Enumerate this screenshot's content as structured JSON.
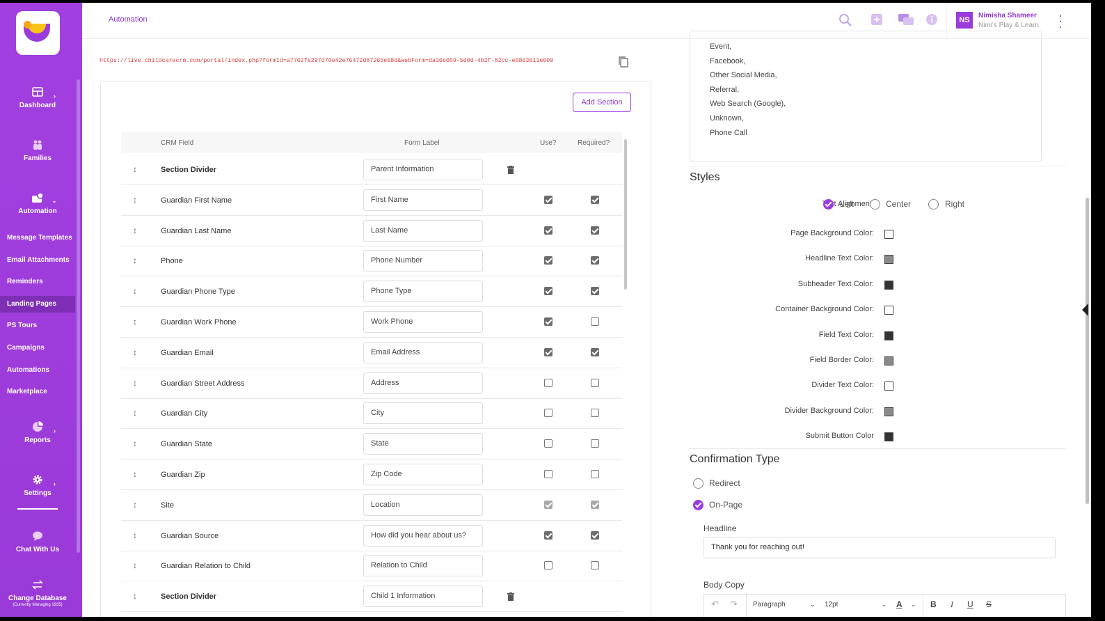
{
  "app": {
    "breadcrumb": "Automation",
    "user": {
      "initials": "NS",
      "name": "Nimisha Shameer",
      "org": "Nimi's Play & Learn"
    },
    "accent_color": "#9b3bdc"
  },
  "sidebar": {
    "main_items": [
      {
        "label": "Dashboard",
        "icon": "dashboard-icon"
      },
      {
        "label": "Families",
        "icon": "families-icon"
      },
      {
        "label": "Automation",
        "icon": "automation-icon"
      }
    ],
    "sub_items": [
      "Message Templates",
      "Email Attachments",
      "Reminders",
      "Landing Pages",
      "PS Tours",
      "Campaigns",
      "Automations",
      "Marketplace"
    ],
    "active_sub_item": "Landing Pages",
    "lower_items": [
      {
        "label": "Reports",
        "icon": "reports-icon"
      },
      {
        "label": "Settings",
        "icon": "gear-icon"
      },
      {
        "label": "Chat With Us",
        "icon": "chat-icon"
      }
    ],
    "change_db": {
      "label": "Change Database",
      "sub": "(Currently Managing 1935)"
    }
  },
  "form": {
    "url": "https://live.childcarecrm.com/portal/index.php?formId=a7762fe297d70e42e76472d87265e68d&webForm=da36e059-5d0d-4b2f-82cc-e0863011e609",
    "add_section_label": "Add Section",
    "columns": {
      "crm_field": "CRM Field",
      "form_label": "Form Label",
      "use": "Use?",
      "required": "Required?"
    },
    "rows": [
      {
        "field": "Section Divider",
        "label": "Parent Information",
        "divider": true
      },
      {
        "field": "Guardian First Name",
        "label": "First Name",
        "use": true,
        "required": true
      },
      {
        "field": "Guardian Last Name",
        "label": "Last Name",
        "use": true,
        "required": true
      },
      {
        "field": "Phone",
        "label": "Phone Number",
        "use": true,
        "required": true
      },
      {
        "field": "Guardian Phone Type",
        "label": "Phone Type",
        "use": true,
        "required": true
      },
      {
        "field": "Guardian Work Phone",
        "label": "Work Phone",
        "use": true,
        "required": false
      },
      {
        "field": "Guardian Email",
        "label": "Email Address",
        "use": true,
        "required": true
      },
      {
        "field": "Guardian Street Address",
        "label": "Address",
        "use": false,
        "required": false
      },
      {
        "field": "Guardian City",
        "label": "City",
        "use": false,
        "required": false
      },
      {
        "field": "Guardian State",
        "label": "State",
        "use": false,
        "required": false
      },
      {
        "field": "Guardian Zip",
        "label": "Zip Code",
        "use": false,
        "required": false
      },
      {
        "field": "Site",
        "label": "Location",
        "use": true,
        "required": true,
        "locked": true
      },
      {
        "field": "Guardian Source",
        "label": "How did you hear about us?",
        "use": true,
        "required": true
      },
      {
        "field": "Guardian Relation to Child",
        "label": "Relation to Child",
        "use": false,
        "required": false
      },
      {
        "field": "Section Divider",
        "label": "Child 1 Information",
        "divider": true
      }
    ]
  },
  "sources": [
    "Event,",
    "Facebook,",
    "Other Social Media,",
    "Referral,",
    "Web Search (Google),",
    "Unknown,",
    "Phone Call"
  ],
  "styles": {
    "title": "Styles",
    "text_alignment": {
      "label": "Text Alignment:",
      "options": [
        "Left",
        "Center",
        "Right"
      ],
      "selected": "Left"
    },
    "colors": [
      {
        "label": "Page Background Color:",
        "color": "#ffffff"
      },
      {
        "label": "Headline Text Color:",
        "color": "#8a8a8a"
      },
      {
        "label": "Subheader Text Color:",
        "color": "#333333"
      },
      {
        "label": "Container Background Color:",
        "color": "#ffffff"
      },
      {
        "label": "Field Text Color:",
        "color": "#333333"
      },
      {
        "label": "Field Border Color:",
        "color": "#8a8a8a"
      },
      {
        "label": "Divider Text Color:",
        "color": "#ffffff"
      },
      {
        "label": "Divider Background Color:",
        "color": "#8a8a8a"
      },
      {
        "label": "Submit Button Color",
        "color": "#333333"
      }
    ]
  },
  "confirmation": {
    "title": "Confirmation Type",
    "options": [
      "Redirect",
      "On-Page"
    ],
    "selected": "On-Page",
    "headline_label": "Headline",
    "headline_value": "Thank you for reaching out!",
    "body_label": "Body Copy",
    "editor": {
      "block": "Paragraph",
      "size": "12pt"
    }
  }
}
